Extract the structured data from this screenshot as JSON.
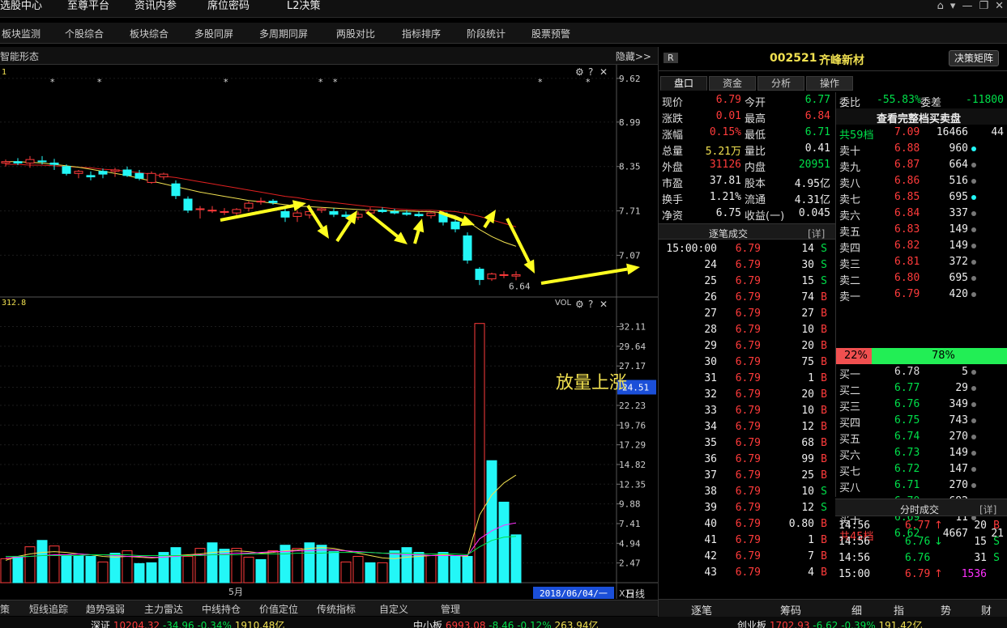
{
  "topmenu": {
    "items": [
      "选股中心",
      "至尊平台",
      "资讯内参",
      "席位密码",
      "L2决策"
    ]
  },
  "toolbar": {
    "items": [
      "板块监测",
      "个股综合",
      "板块综合",
      "多股同屏",
      "多周期同屏",
      "两股对比",
      "指标排序",
      "阶段统计",
      "股票预警"
    ]
  },
  "chart": {
    "title": "智能形态",
    "hide_label": "隐藏>>",
    "price_corner": "1",
    "vol_corner": "312.8",
    "vol_label": "VOL",
    "low_label": "6.64",
    "month_label": "5月",
    "date_label": "2018/06/04/一",
    "unit_label": "X万",
    "period_label": "日线",
    "annotation": "放量上涨",
    "vol_current": "24.51"
  },
  "chart_data": [
    {
      "type": "candlestick",
      "price_axis_ticks": [
        "9.62",
        "8.99",
        "8.35",
        "7.71",
        "7.07"
      ],
      "price_range": [
        6.55,
        9.7
      ],
      "candles": [
        [
          8.4,
          8.45,
          8.35,
          8.42
        ],
        [
          8.42,
          8.47,
          8.37,
          8.4
        ],
        [
          8.4,
          8.5,
          8.33,
          8.45
        ],
        [
          8.43,
          8.5,
          8.38,
          8.42
        ],
        [
          8.4,
          8.46,
          8.3,
          8.38
        ],
        [
          8.35,
          8.38,
          8.22,
          8.25
        ],
        [
          8.25,
          8.3,
          8.18,
          8.28
        ],
        [
          8.22,
          8.28,
          8.15,
          8.2
        ],
        [
          8.28,
          8.32,
          8.18,
          8.24
        ],
        [
          8.28,
          8.33,
          8.2,
          8.3
        ],
        [
          8.3,
          8.35,
          8.2,
          8.22
        ],
        [
          8.25,
          8.3,
          8.15,
          8.18
        ],
        [
          8.12,
          8.28,
          8.1,
          8.25
        ],
        [
          8.2,
          8.26,
          8.16,
          8.24
        ],
        [
          8.1,
          8.15,
          7.88,
          7.93
        ],
        [
          7.88,
          7.92,
          7.68,
          7.72
        ],
        [
          7.73,
          7.78,
          7.6,
          7.74
        ],
        [
          7.72,
          7.78,
          7.68,
          7.72
        ],
        [
          7.7,
          7.75,
          7.65,
          7.7
        ],
        [
          7.68,
          7.75,
          7.62,
          7.73
        ],
        [
          7.75,
          7.85,
          7.7,
          7.82
        ],
        [
          7.84,
          7.9,
          7.8,
          7.85
        ],
        [
          7.85,
          7.88,
          7.8,
          7.83
        ],
        [
          7.7,
          7.76,
          7.55,
          7.62
        ],
        [
          7.63,
          7.72,
          7.55,
          7.68
        ],
        [
          7.65,
          7.74,
          7.6,
          7.7
        ],
        [
          7.72,
          7.76,
          7.68,
          7.74
        ],
        [
          7.7,
          7.75,
          7.62,
          7.66
        ],
        [
          7.65,
          7.7,
          7.6,
          7.63
        ],
        [
          7.62,
          7.7,
          7.58,
          7.66
        ],
        [
          7.68,
          7.76,
          7.65,
          7.72
        ],
        [
          7.72,
          7.76,
          7.68,
          7.7
        ],
        [
          7.7,
          7.74,
          7.66,
          7.68
        ],
        [
          7.68,
          7.72,
          7.64,
          7.66
        ],
        [
          7.66,
          7.7,
          7.62,
          7.64
        ],
        [
          7.64,
          7.7,
          7.6,
          7.68
        ],
        [
          7.68,
          7.7,
          7.5,
          7.55
        ],
        [
          7.55,
          7.6,
          7.4,
          7.45
        ],
        [
          7.35,
          7.4,
          6.95,
          7.0
        ],
        [
          6.87,
          6.9,
          6.64,
          6.72
        ],
        [
          6.73,
          6.82,
          6.7,
          6.8
        ],
        [
          6.78,
          6.84,
          6.74,
          6.79
        ],
        [
          6.77,
          6.84,
          6.71,
          6.79
        ]
      ],
      "ma_yellow": [
        8.42,
        8.42,
        8.41,
        8.4,
        8.38,
        8.36,
        8.34,
        8.31,
        8.28,
        8.25,
        8.22,
        8.18,
        8.14,
        8.1,
        8.06,
        8.02,
        7.98,
        7.95,
        7.92,
        7.89,
        7.86,
        7.84,
        7.82,
        7.8,
        7.78,
        7.77,
        7.76,
        7.75,
        7.74,
        7.73,
        7.72,
        7.72,
        7.71,
        7.71,
        7.7,
        7.7,
        7.68,
        7.64,
        7.56,
        7.44,
        7.34,
        7.26,
        7.2
      ],
      "ma_red": [
        8.38,
        8.38,
        8.37,
        8.37,
        8.36,
        8.35,
        8.34,
        8.33,
        8.31,
        8.3,
        8.28,
        8.26,
        8.24,
        8.21,
        8.19,
        8.16,
        8.13,
        8.1,
        8.07,
        8.04,
        8.01,
        7.98,
        7.95,
        7.92,
        7.9,
        7.87,
        7.85,
        7.83,
        7.81,
        7.79,
        7.77,
        7.76,
        7.74,
        7.73,
        7.72,
        7.72,
        7.71,
        7.7,
        7.67,
        7.63,
        7.58,
        7.53,
        7.48
      ]
    },
    {
      "type": "bar",
      "title": "VOL",
      "vol_axis_ticks": [
        "32.11",
        "29.64",
        "27.17",
        "24.51",
        "22.23",
        "19.76",
        "17.29",
        "14.82",
        "12.35",
        "9.88",
        "7.41",
        "4.94",
        "2.47"
      ],
      "vol_range": [
        0,
        34.5
      ],
      "volumes": [
        3.0,
        3.3,
        4.5,
        5.3,
        4.6,
        3.5,
        3.4,
        3.3,
        2.6,
        3.7,
        4.0,
        2.4,
        2.5,
        3.8,
        4.4,
        3.3,
        4.3,
        5.0,
        4.2,
        4.3,
        3.2,
        2.9,
        4.0,
        4.7,
        4.3,
        5.0,
        4.7,
        3.9,
        2.6,
        3.3,
        2.5,
        2.5,
        4.0,
        4.4,
        3.8,
        3.4,
        3.8,
        3.4,
        3.3,
        32.5,
        15.3,
        10.1,
        6.0
      ],
      "vol_up": [
        true,
        false,
        true,
        false,
        true,
        false,
        false,
        false,
        true,
        false,
        true,
        false,
        false,
        false,
        false,
        true,
        true,
        false,
        false,
        true,
        true,
        false,
        true,
        false,
        true,
        false,
        false,
        false,
        true,
        true,
        false,
        true,
        false,
        false,
        false,
        true,
        false,
        false,
        false,
        true,
        false,
        false,
        false
      ],
      "ma_yellow": [
        2.8,
        3.3,
        3.6,
        3.8,
        3.9,
        3.8,
        3.6,
        3.5,
        3.3,
        3.2,
        3.3,
        3.2,
        3.1,
        3.2,
        3.4,
        3.5,
        3.6,
        3.8,
        3.9,
        4.0,
        3.9,
        3.7,
        3.8,
        4.0,
        4.1,
        4.3,
        4.4,
        4.3,
        4.0,
        3.7,
        3.4,
        3.1,
        3.0,
        3.2,
        3.3,
        3.4,
        3.5,
        3.4,
        3.3,
        8.5,
        11.0,
        12.5,
        13.5
      ],
      "ma_magenta": [
        3.1,
        3.2,
        3.3,
        3.4,
        3.5,
        3.5,
        3.6,
        3.5,
        3.5,
        3.4,
        3.3,
        3.3,
        3.2,
        3.2,
        3.3,
        3.4,
        3.5,
        3.5,
        3.6,
        3.7,
        3.7,
        3.8,
        3.9,
        3.9,
        4.0,
        4.0,
        4.1,
        4.1,
        4.0,
        3.9,
        3.8,
        3.7,
        3.6,
        3.5,
        3.5,
        3.4,
        3.4,
        3.4,
        3.4,
        5.5,
        6.5,
        7.2,
        7.5
      ],
      "ma_green": [
        3.3,
        3.3,
        3.3,
        3.4,
        3.4,
        3.4,
        3.4,
        3.5,
        3.5,
        3.5,
        3.5,
        3.4,
        3.4,
        3.4,
        3.4,
        3.4,
        3.4,
        3.5,
        3.5,
        3.5,
        3.6,
        3.6,
        3.6,
        3.6,
        3.7,
        3.7,
        3.7,
        3.8,
        3.8,
        3.8,
        3.8,
        3.7,
        3.7,
        3.7,
        3.6,
        3.6,
        3.6,
        3.6,
        3.5,
        4.5,
        5.3,
        5.7,
        5.8
      ]
    }
  ],
  "bottomtabs": [
    "策",
    "短线追踪",
    "趋势强弱",
    "主力雷达",
    "中线持仓",
    "价值定位",
    "传统指标",
    "自定义",
    "管理"
  ],
  "statusbar": [
    {
      "name": "深证",
      "value": "10204.32",
      "chg": "-34.96",
      "pct": "-0.34%",
      "amt": "1910.48亿"
    },
    {
      "name": "中小板",
      "value": "6993.08",
      "chg": "-8.46",
      "pct": "-0.12%",
      "amt": "263.94亿"
    },
    {
      "name": "创业板",
      "value": "1702.93",
      "chg": "-6.62",
      "pct": "-0.39%",
      "amt": "191.42亿"
    }
  ],
  "stock": {
    "badge": "R",
    "code": "002521",
    "name": "齐峰新材",
    "matrix_button": "决策矩阵"
  },
  "rtabs": [
    "盘口",
    "资金",
    "分析",
    "操作"
  ],
  "quote": [
    {
      "l1": "现价",
      "v1": "6.79",
      "c1": "red",
      "l2": "今开",
      "v2": "6.77",
      "c2": "green"
    },
    {
      "l1": "涨跌",
      "v1": "0.01",
      "c1": "red",
      "l2": "最高",
      "v2": "6.84",
      "c2": "red"
    },
    {
      "l1": "涨幅",
      "v1": "0.15%",
      "c1": "red",
      "l2": "最低",
      "v2": "6.71",
      "c2": "green"
    },
    {
      "l1": "总量",
      "v1": "5.21万",
      "c1": "yellow",
      "l2": "量比",
      "v2": "0.41",
      "c2": "white"
    },
    {
      "l1": "外盘",
      "v1": "31126",
      "c1": "red",
      "l2": "内盘",
      "v2": "20951",
      "c2": "green"
    },
    {
      "l1": "市盈",
      "v1": "37.81",
      "c1": "white",
      "l2": "股本",
      "v2": "4.95亿",
      "c2": "white"
    },
    {
      "l1": "换手",
      "v1": "1.21%",
      "c1": "white",
      "l2": "流通",
      "v2": "4.31亿",
      "c2": "white"
    },
    {
      "l1": "净资",
      "v1": "6.75",
      "c1": "white",
      "l2": "收益(一)",
      "v2": "0.045",
      "c2": "white"
    }
  ],
  "trades": {
    "title": "逐笔成交",
    "detail": "[详]",
    "rows": [
      [
        "15:00:00",
        "6.79",
        "14",
        "S"
      ],
      [
        "24",
        "6.79",
        "30",
        "S"
      ],
      [
        "25",
        "6.79",
        "15",
        "S"
      ],
      [
        "26",
        "6.79",
        "74",
        "B"
      ],
      [
        "27",
        "6.79",
        "27",
        "B"
      ],
      [
        "28",
        "6.79",
        "10",
        "B"
      ],
      [
        "29",
        "6.79",
        "20",
        "B"
      ],
      [
        "30",
        "6.79",
        "75",
        "B"
      ],
      [
        "31",
        "6.79",
        "1",
        "B"
      ],
      [
        "32",
        "6.79",
        "20",
        "B"
      ],
      [
        "33",
        "6.79",
        "10",
        "B"
      ],
      [
        "34",
        "6.79",
        "12",
        "B"
      ],
      [
        "35",
        "6.79",
        "68",
        "B"
      ],
      [
        "36",
        "6.79",
        "99",
        "B"
      ],
      [
        "37",
        "6.79",
        "25",
        "B"
      ],
      [
        "38",
        "6.79",
        "10",
        "S"
      ],
      [
        "39",
        "6.79",
        "12",
        "S"
      ],
      [
        "40",
        "6.79",
        "0.80",
        "B"
      ],
      [
        "41",
        "6.79",
        "1",
        "B"
      ],
      [
        "42",
        "6.79",
        "7",
        "B"
      ],
      [
        "43",
        "6.79",
        "4",
        "B"
      ]
    ]
  },
  "book": {
    "ratio_label": "委比",
    "ratio": "-55.83%",
    "diff_label": "委差",
    "diff": "-11800",
    "full_link": "查看完整档买卖盘",
    "ask_total": {
      "label": "共59档",
      "price": "7.09",
      "vol": "16466",
      "n": "44"
    },
    "asks": [
      [
        "卖十",
        "6.88",
        "960",
        "cyan"
      ],
      [
        "卖九",
        "6.87",
        "664",
        "gray"
      ],
      [
        "卖八",
        "6.86",
        "516",
        "gray"
      ],
      [
        "卖七",
        "6.85",
        "695",
        "cyan"
      ],
      [
        "卖六",
        "6.84",
        "337",
        "gray"
      ],
      [
        "卖五",
        "6.83",
        "149",
        "gray"
      ],
      [
        "卖四",
        "6.82",
        "149",
        "gray"
      ],
      [
        "卖三",
        "6.81",
        "372",
        "gray"
      ],
      [
        "卖二",
        "6.80",
        "695",
        "gray"
      ],
      [
        "卖一",
        "6.79",
        "420",
        "gray"
      ]
    ],
    "sell_pct": "22%",
    "buy_pct": "78%",
    "bids": [
      [
        "买一",
        "6.78",
        "5",
        "gray"
      ],
      [
        "买二",
        "6.77",
        "29",
        "gray"
      ],
      [
        "买三",
        "6.76",
        "349",
        "gray"
      ],
      [
        "买四",
        "6.75",
        "743",
        "gray"
      ],
      [
        "买五",
        "6.74",
        "270",
        "gray"
      ],
      [
        "买六",
        "6.73",
        "149",
        "gray"
      ],
      [
        "买七",
        "6.72",
        "147",
        "gray"
      ],
      [
        "买八",
        "6.71",
        "270",
        "gray"
      ],
      [
        "买九",
        "6.70",
        "692",
        "magenta"
      ],
      [
        "买十",
        "6.69",
        "11",
        "gray"
      ]
    ],
    "bid_total": {
      "label": "共45档",
      "price": "6.62",
      "vol": "4667",
      "n": "21"
    }
  },
  "mintrades": {
    "title": "分时成交",
    "detail": "[详]",
    "rows": [
      [
        "14:56",
        "6.77",
        "↑",
        "20",
        "B",
        "red"
      ],
      [
        "14:56",
        "6.76",
        "↓",
        "15",
        "S",
        "green"
      ],
      [
        "14:56",
        "6.76",
        "",
        "31",
        "S",
        "green"
      ],
      [
        "15:00",
        "6.79",
        "↑",
        "1536",
        "",
        "red"
      ]
    ]
  },
  "rbottom": [
    "逐笔",
    "筹码",
    "细",
    "指",
    "势",
    "财"
  ],
  "colors": {
    "up": "#ff3b3b",
    "down": "#23f7f7",
    "yellow": "#f0e050",
    "green": "#00e04a",
    "magenta": "#ff30ff",
    "arrow": "#ffff20"
  }
}
